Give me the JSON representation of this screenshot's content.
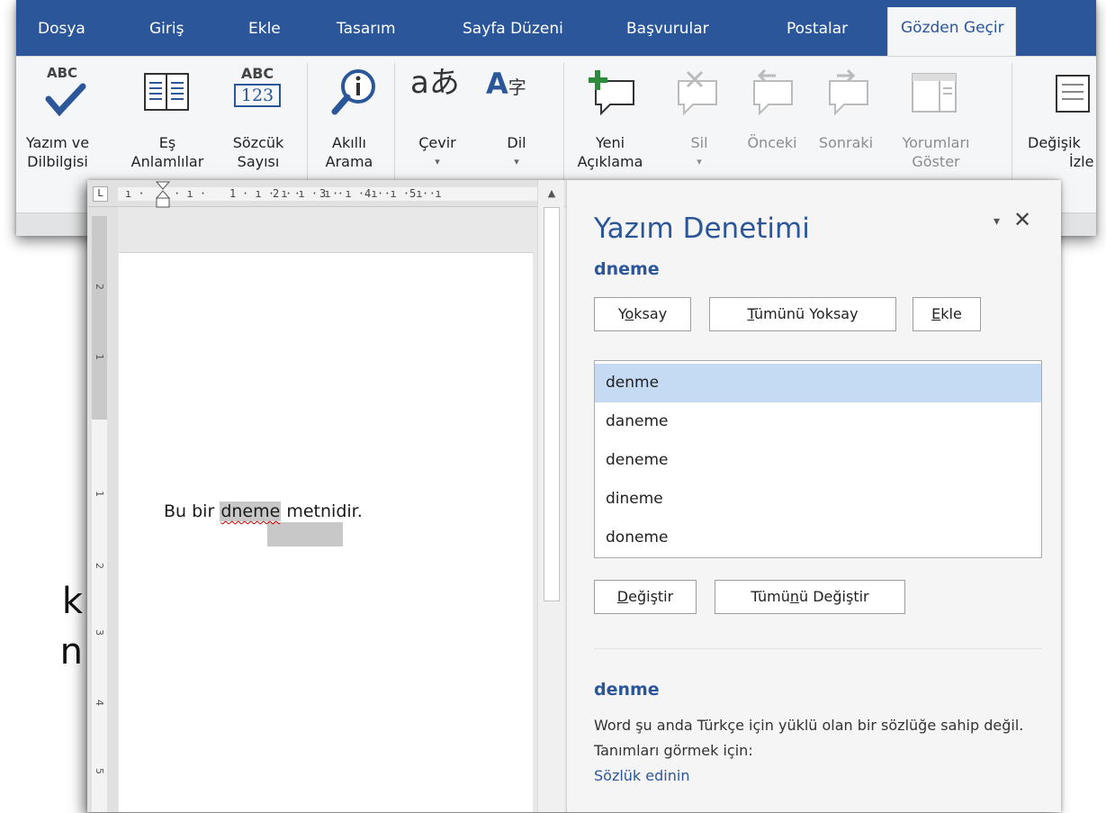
{
  "background": {
    "text_lines": [
      "k",
      "n"
    ]
  },
  "ribbon": {
    "tabs": [
      {
        "label": "Dosya",
        "active": false
      },
      {
        "label": "Giriş",
        "active": false
      },
      {
        "label": "Ekle",
        "active": false
      },
      {
        "label": "Tasarım",
        "active": false
      },
      {
        "label": "Sayfa Düzeni",
        "active": false
      },
      {
        "label": "Başvurular",
        "active": false
      },
      {
        "label": "Postalar",
        "active": false
      },
      {
        "label": "Gözden Geçir",
        "active": true
      }
    ],
    "buttons": {
      "spelling": {
        "line1": "Yazım ve",
        "line2": "Dilbilgisi"
      },
      "thesaurus": {
        "line1": "Eş",
        "line2": "Anlamlılar"
      },
      "wordcount": {
        "line1": "Sözcük",
        "line2": "Sayısı",
        "icon_top": "ABC",
        "icon_bottom": "123"
      },
      "smartlookup": {
        "line1": "Akıllı",
        "line2": "Arama"
      },
      "translate": {
        "line1": "Çevir",
        "line2": "▾"
      },
      "language": {
        "line1": "Dil",
        "line2": "▾"
      },
      "newcomment": {
        "line1": "Yeni",
        "line2": "Açıklama"
      },
      "delete": {
        "line1": "Sil",
        "line2": "▾"
      },
      "previous": {
        "line1": "Önceki"
      },
      "next": {
        "line1": "Sonraki"
      },
      "showcomments": {
        "line1": "Yorumları",
        "line2": "Göster"
      },
      "track": {
        "line1": "Değişik",
        "line2": "İzle"
      }
    },
    "spelling_icon_text": "ABC"
  },
  "ruler": {
    "tab_stop": "L",
    "h_numbers": [
      "1",
      "2",
      "3",
      "4",
      "5"
    ],
    "v_numbers": [
      "2",
      "1",
      "1",
      "2",
      "3",
      "4",
      "5"
    ]
  },
  "document": {
    "before": "Bu bir ",
    "error_word": "dneme",
    "after": " metnidir."
  },
  "pane": {
    "title": "Yazım Denetimi",
    "menu_icon": "▾",
    "close_icon": "✕",
    "word": "dneme",
    "ignore_label_pre": "Y",
    "ignore_label_u": "o",
    "ignore_label_post": "ksay",
    "ignore_all_u": "T",
    "ignore_all_post": "ümünü Yoksay",
    "add_u": "E",
    "add_post": "kle",
    "suggestions": [
      "denme",
      "daneme",
      "deneme",
      "dineme",
      "doneme"
    ],
    "selected_index": 0,
    "change_u": "D",
    "change_post": "eğiştir",
    "change_all_pre": "Tümü",
    "change_all_u": "n",
    "change_all_post": "ü Değiştir",
    "definition_word": "denme",
    "definition_text": "Word şu anda Türkçe için yüklü olan bir sözlüğe sahip değil. Tanımları görmek için:",
    "dictionary_link": "Sözlük edinin"
  },
  "colors": {
    "accent": "#2b579a",
    "selection": "#c5daf3",
    "error_underline": "#cc0000"
  }
}
